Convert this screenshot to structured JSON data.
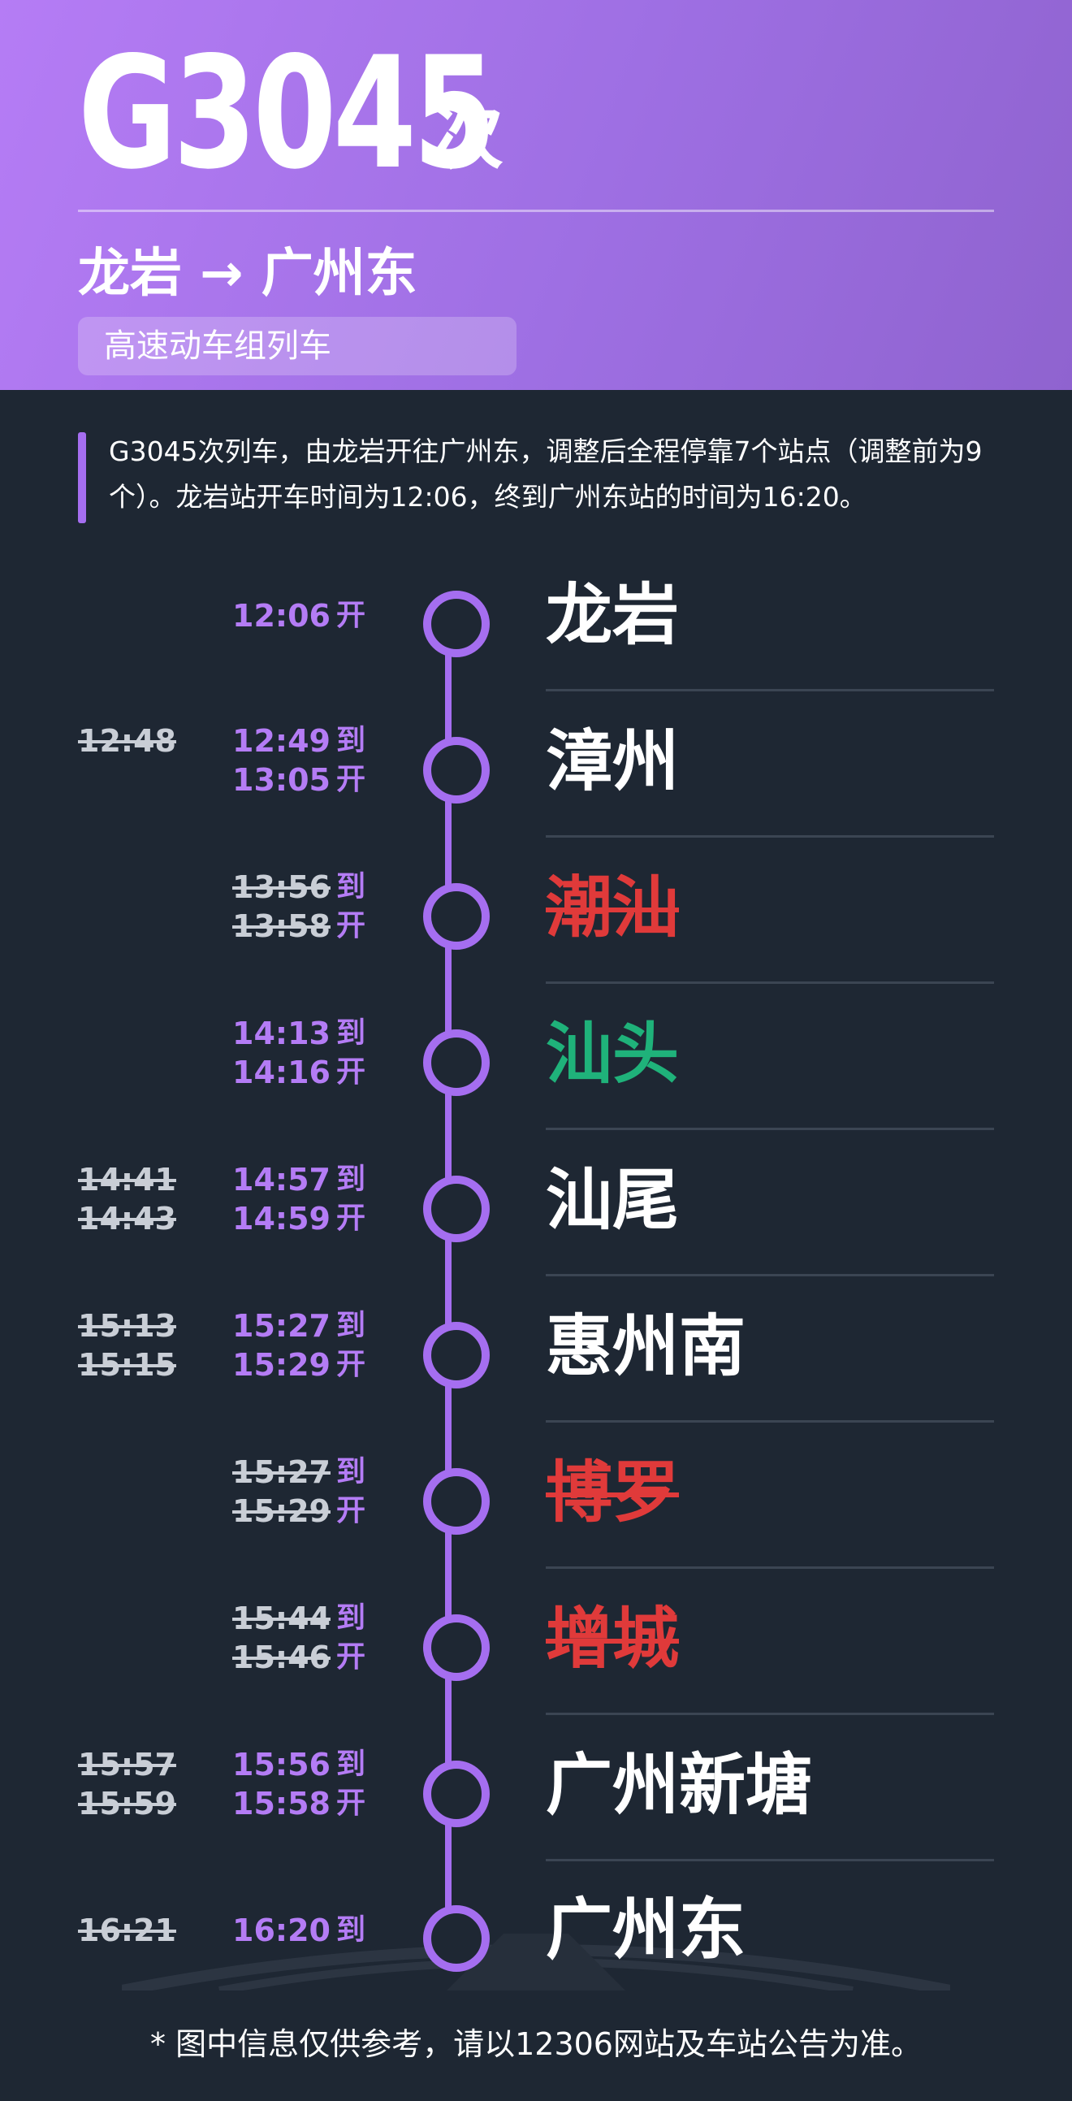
{
  "header": {
    "train_number": "G3045",
    "train_suffix": "次",
    "route_from": "龙岩",
    "route_arrow": "→",
    "route_to": "广州东",
    "train_type": "高速动车组列车"
  },
  "summary": "G3045次列车，由龙岩开往广州东，调整后全程停靠7个站点（调整前为9个）。龙岩站开车时间为12:06，终到广州东站的时间为16:20。",
  "colors": {
    "header_gradient_start": "#b57cf5",
    "header_gradient_end": "#8f63cf",
    "accent": "#a56ef0",
    "time_text": "#b47cf5",
    "background": "#1e2733",
    "cancelled": "#e03a3a",
    "added": "#1fb27a"
  },
  "labels": {
    "arrive": "到",
    "depart": "开"
  },
  "stops": [
    {
      "name": "龙岩",
      "status": "normal",
      "old_arrive": "",
      "old_depart": "",
      "new_arrive": "",
      "new_depart": "12:06"
    },
    {
      "name": "漳州",
      "status": "normal",
      "old_arrive": "12:48",
      "old_depart": "",
      "new_arrive": "12:49",
      "new_depart": "13:05"
    },
    {
      "name": "潮汕",
      "status": "cancelled",
      "old_arrive": "",
      "old_depart": "",
      "new_arrive": "13:56",
      "new_depart": "13:58"
    },
    {
      "name": "汕头",
      "status": "added",
      "old_arrive": "",
      "old_depart": "",
      "new_arrive": "14:13",
      "new_depart": "14:16"
    },
    {
      "name": "汕尾",
      "status": "normal",
      "old_arrive": "14:41",
      "old_depart": "14:43",
      "new_arrive": "14:57",
      "new_depart": "14:59"
    },
    {
      "name": "惠州南",
      "status": "normal",
      "old_arrive": "15:13",
      "old_depart": "15:15",
      "new_arrive": "15:27",
      "new_depart": "15:29"
    },
    {
      "name": "博罗",
      "status": "cancelled",
      "old_arrive": "",
      "old_depart": "",
      "new_arrive": "15:27",
      "new_depart": "15:29"
    },
    {
      "name": "增城",
      "status": "cancelled",
      "old_arrive": "",
      "old_depart": "",
      "new_arrive": "15:44",
      "new_depart": "15:46"
    },
    {
      "name": "广州新塘",
      "status": "normal",
      "old_arrive": "15:57",
      "old_depart": "15:59",
      "new_arrive": "15:56",
      "new_depart": "15:58"
    },
    {
      "name": "广州东",
      "status": "normal",
      "old_arrive": "16:21",
      "old_depart": "",
      "new_arrive": "16:20",
      "new_depart": ""
    }
  ],
  "footer": "* 图中信息仅供参考，请以12306网站及车站公告为准。"
}
